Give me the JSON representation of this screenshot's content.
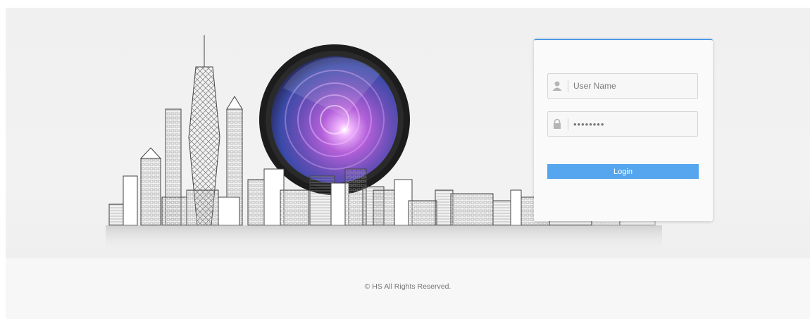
{
  "login": {
    "username_placeholder": "User Name",
    "password_value": "12345678",
    "login_label": "Login"
  },
  "footer": {
    "copyright": "©  HS  All Rights Reserved."
  },
  "colors": {
    "accent": "#55a6ee",
    "panel_border": "#4c9be8",
    "banner_bg": "#f0f0f0"
  },
  "icons": {
    "user_field": "user-icon",
    "password_field": "lock-icon"
  }
}
